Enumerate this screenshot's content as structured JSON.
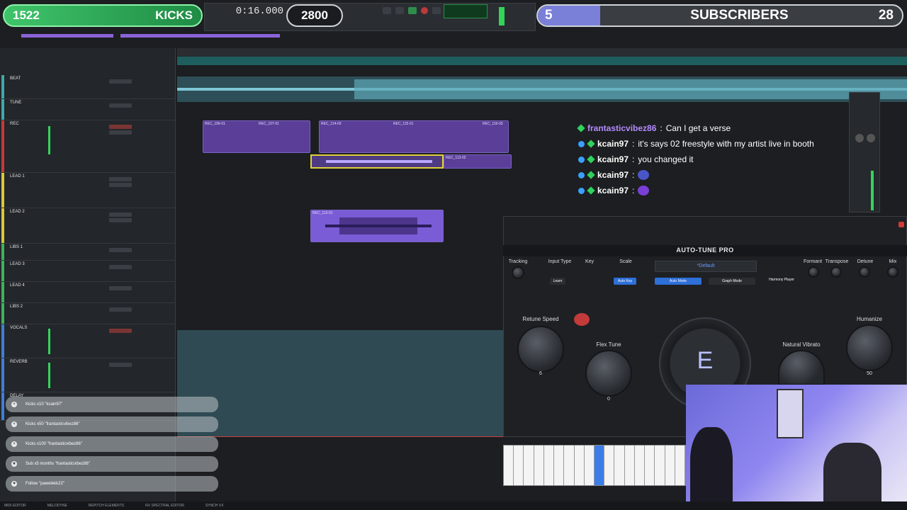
{
  "kicks": {
    "count": "1522",
    "label": "KICKS"
  },
  "subscribers": {
    "count_left": "5",
    "label": "SUBSCRIBERS",
    "count_right": "28"
  },
  "transport": {
    "counter": "0:16.000",
    "goal_count": "2800"
  },
  "tracks": [
    {
      "name": "BEAT"
    },
    {
      "name": "TUNE"
    },
    {
      "name": "REC"
    },
    {
      "name": "LEAD 1"
    },
    {
      "name": "LEAD 2"
    },
    {
      "name": "LIBS 1"
    },
    {
      "name": "LEAD 3"
    },
    {
      "name": "LEAD 4"
    },
    {
      "name": "LIBS 2"
    },
    {
      "name": "VOCALS"
    },
    {
      "name": "REVERB"
    },
    {
      "name": "DELAY"
    }
  ],
  "clips": {
    "rec1": "REC_106-01",
    "rec2": "REC_107-01",
    "rec3": "REC_114-03",
    "rec4": "REC_115-01",
    "rec5": "REC_116-03",
    "rec6": "REC_113-02",
    "lead": "REC_113-01"
  },
  "chat": [
    {
      "user": "frantasticvibez86",
      "message": "Can I get a verse",
      "style": "a"
    },
    {
      "user": "kcain97",
      "message": "it's says 02 freestyle with my artist live in booth",
      "style": "b"
    },
    {
      "user": "kcain97",
      "message": "you changed it",
      "style": "b"
    },
    {
      "user": "kcain97",
      "message": "",
      "style": "b"
    },
    {
      "user": "kcain97",
      "message": "",
      "style": "b"
    }
  ],
  "autotune": {
    "title": "AUTO-TUNE PRO",
    "preset": "*Default",
    "labels": {
      "tracking": "Tracking",
      "input_type": "Input Type",
      "key": "Key",
      "scale": "Scale",
      "formant": "Formant",
      "transpose": "Transpose",
      "detune": "Detune",
      "mix": "Mix",
      "retune_speed": "Retune Speed",
      "flex_tune": "Flex Tune",
      "natural_vibrato": "Natural Vibrato",
      "humanize": "Humanize"
    },
    "buttons": {
      "learn": "Learn",
      "auto_key": "Auto Key",
      "auto_mode": "Auto Mode",
      "graph_mode": "Graph Mode",
      "harmony_player": "Harmony Player"
    },
    "values": {
      "retune_speed": "6",
      "flex_tune": "0",
      "humanize": "50"
    },
    "note": "E"
  },
  "alerts": [
    {
      "text": "Kicks x10 \"kcain97\"",
      "icon": "close-icon"
    },
    {
      "text": "Kicks x50 \"frantasticvibez86\"",
      "icon": "close-icon"
    },
    {
      "text": "Kicks x100 \"frantasticvibez86\"",
      "icon": "close-icon"
    },
    {
      "text": "Sub x5 months \"frantasticvibez86\"",
      "icon": "star-icon"
    },
    {
      "text": "Follow \"pawelekk22\"",
      "icon": "heart-icon"
    }
  ],
  "bottombar": [
    "MIDI EDITOR",
    "MELODYNE",
    "REPITCH ELEMENTS",
    "RX SPECTRAL EDITOR",
    "SYNCH VX"
  ],
  "colors": {
    "kicks_green": "#3fc46a",
    "accent_purple": "#5a3e98",
    "subs_fill": "#7a7fd8",
    "teal": "#2f4a52"
  }
}
